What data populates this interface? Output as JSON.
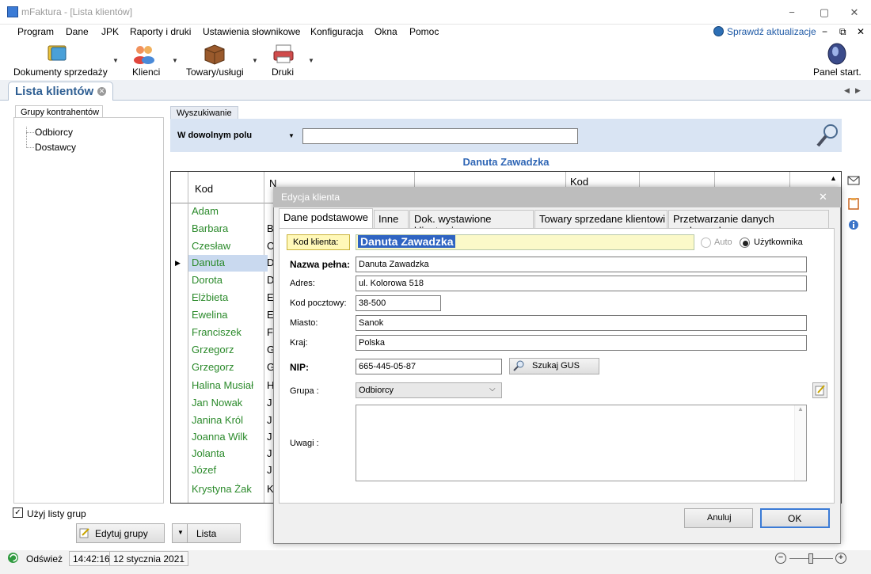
{
  "window": {
    "title": "mFaktura - [Lista klientów]",
    "controls": [
      "−",
      "▢",
      "✕"
    ]
  },
  "menu": {
    "items": [
      "Program",
      "Dane",
      "JPK",
      "Raporty i druki",
      "Ustawienia słownikowe",
      "Konfiguracja",
      "Okna",
      "Pomoc"
    ],
    "update_link": "Sprawdź aktualizacje",
    "mdi_controls": [
      "−",
      "⧉",
      "✕"
    ]
  },
  "toolbar": {
    "items": [
      {
        "label": "Dokumenty sprzedaży",
        "icon": "book-icon"
      },
      {
        "label": "Klienci",
        "icon": "people-icon"
      },
      {
        "label": "Towary/usługi",
        "icon": "box-icon"
      },
      {
        "label": "Druki",
        "icon": "printer-icon"
      }
    ],
    "panel_label": "Panel start."
  },
  "tab": {
    "label": "Lista klientów",
    "close": "✕"
  },
  "groups": {
    "tab_label": "Grupy kontrahentów",
    "items": [
      "Odbiorcy",
      "Dostawcy"
    ],
    "use_groups_label": "Użyj listy grup",
    "use_groups_checked": true,
    "edit_button": "Edytuj grupy",
    "list_button": "Lista"
  },
  "search": {
    "tab_label": "Wyszukiwanie",
    "field_selector": "W dowolnym polu",
    "query": ""
  },
  "selected_client_header": "Danuta Zawadzka",
  "grid": {
    "header_kod": "Kod",
    "header_n": "N",
    "header_kod2": "Kod",
    "rows": [
      {
        "name": "Adam",
        "col2": "A"
      },
      {
        "name": "Barbara",
        "col2": "B"
      },
      {
        "name": "Czesław",
        "col2": "C"
      },
      {
        "name": "Danuta",
        "col2": "D",
        "selected": true
      },
      {
        "name": "Dorota",
        "col2": "D"
      },
      {
        "name": "Elżbieta",
        "col2": "E"
      },
      {
        "name": "Ewelina",
        "col2": "E"
      },
      {
        "name": "Franciszek",
        "col2": "F"
      },
      {
        "name": "Grzegorz",
        "col2": "G"
      },
      {
        "name": "Grzegorz",
        "col2": "G"
      },
      {
        "name": "Halina Musiał",
        "col2": "H"
      },
      {
        "name": "Jan Nowak",
        "col2": "J"
      },
      {
        "name": "Janina Król",
        "col2": "J"
      },
      {
        "name": "Joanna Wilk",
        "col2": "J"
      },
      {
        "name": "Jolanta",
        "col2": "J"
      },
      {
        "name": "Józef",
        "col2": "J"
      },
      {
        "name": "Krystyna Żak",
        "col2": "K"
      }
    ]
  },
  "dialog": {
    "title": "Edycja klienta",
    "close": "✕",
    "tabs": [
      "Dane podstawowe",
      "Inne",
      "Dok. wystawione klientowi",
      "Towary sprzedane klientowi",
      "Przetwarzanie danych osobowych"
    ],
    "code_label": "Kod klienta:",
    "code_value": "Danuta Zawadzka",
    "mode_auto": "Auto",
    "mode_user": "Użytkownika",
    "fields": {
      "full_name_label": "Nazwa pełna:",
      "full_name": "Danuta Zawadzka",
      "address_label": "Adres:",
      "address": "ul. Kolorowa 518",
      "postal_label": "Kod pocztowy:",
      "postal": "38-500",
      "city_label": "Miasto:",
      "city": "Sanok",
      "country_label": "Kraj:",
      "country": "Polska",
      "nip_label": "NIP:",
      "nip": "665-445-05-87",
      "gus_button": "Szukaj GUS",
      "group_label": "Grupa :",
      "group": "Odbiorcy",
      "notes_label": "Uwagi :",
      "notes": ""
    },
    "cancel_button": "Anuluj",
    "ok_button": "OK"
  },
  "status": {
    "refresh_label": "Odśwież",
    "time": "14:42:16",
    "date": "12 stycznia 2021"
  },
  "colors": {
    "accent": "#2f5f93",
    "name_green": "#2b8a2b",
    "search_bg": "#d9e4f3",
    "selection_blue": "#2f64c2"
  }
}
